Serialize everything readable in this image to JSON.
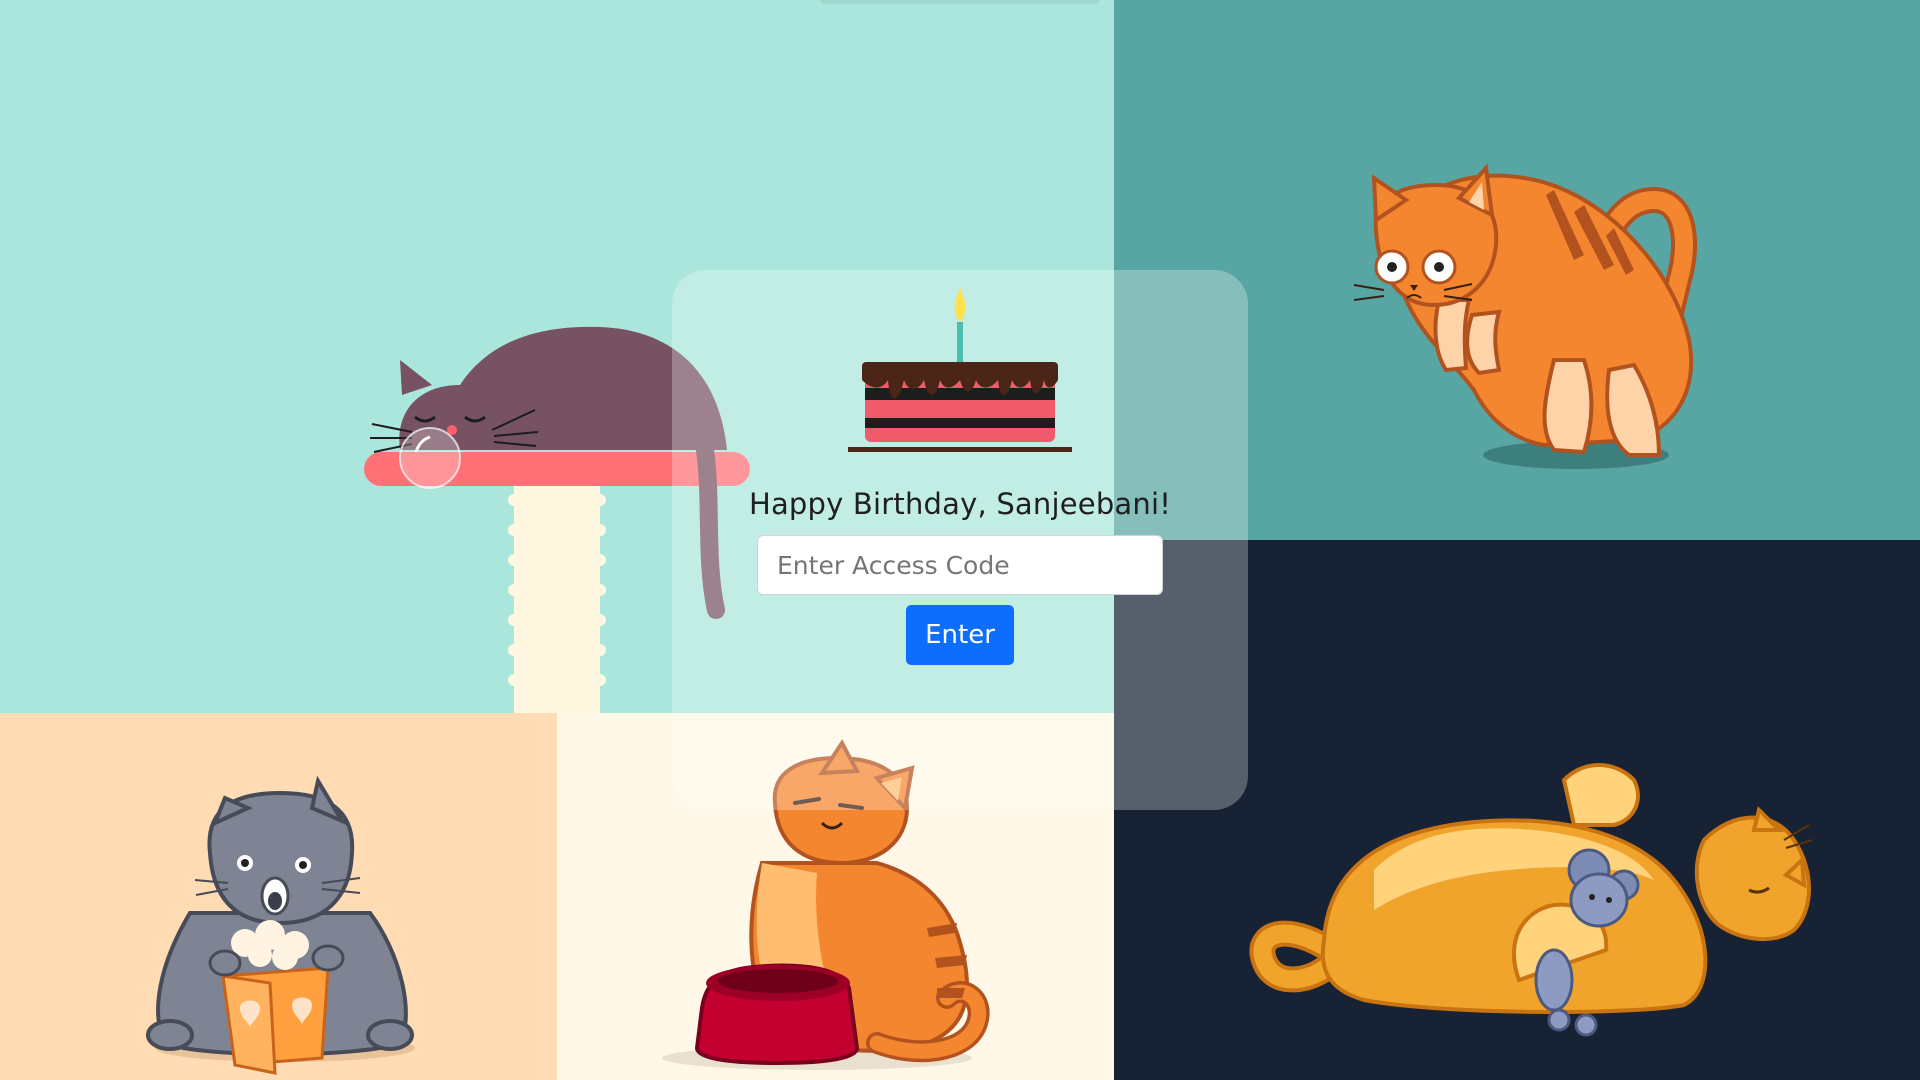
{
  "colors": {
    "panel_top_left": "#abe6dc",
    "panel_top_right": "#58a6a3",
    "panel_bottom_left": "#ffdcb4",
    "panel_bottom_middle": "#fff8e8",
    "panel_bottom_right": "#172234",
    "button": "#0d6efd"
  },
  "illustrations": [
    "sleeping-cat-on-scratching-post",
    "startled-orange-cat",
    "gray-cat-with-popcorn",
    "orange-cat-with-food-bowl",
    "sleeping-orange-cat-hugging-mouse-toy"
  ],
  "card": {
    "icon": "birthday-cake-icon",
    "greeting": "Happy Birthday, Sanjeebani!",
    "input_placeholder": "Enter Access Code",
    "input_value": "",
    "button_label": "Enter"
  }
}
